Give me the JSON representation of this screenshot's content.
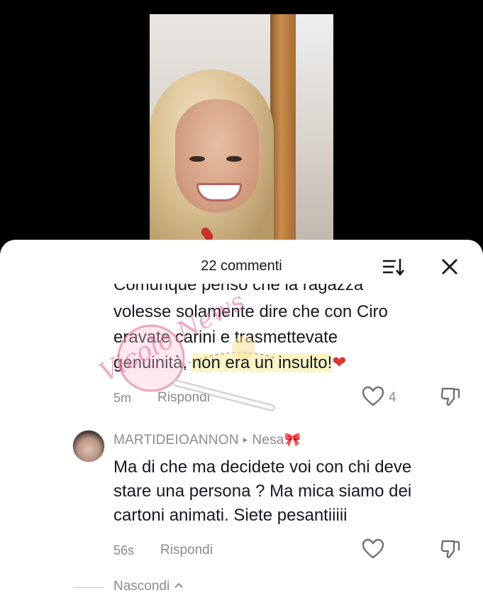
{
  "video": {
    "description_icon": "video-thumbnail"
  },
  "header": {
    "title": "22 commenti",
    "sort_icon": "sort-icon",
    "close_icon": "close-icon"
  },
  "comment1": {
    "line0": "Comunque penso che la ragazza",
    "line1": "volesse solamente dire che con Ciro",
    "line2": "eravate carini e trasmettevate",
    "line3a": "genuinità,",
    "line3b": "non era un insulto!",
    "emoji": "❤",
    "time": "5m",
    "reply": "Rispondi",
    "likes": "4"
  },
  "comment2": {
    "username": "MARTIDEIOANNON",
    "arrow": "▸",
    "reply_to": "Nesa",
    "bow": "🎀",
    "line1": "Ma di che ma decidete voi con chi deve",
    "line2": "stare una persona ? Ma mica siamo dei",
    "line3": "cartoni animati. Siete pesantiiiii",
    "time": "56s",
    "reply": "Rispondi"
  },
  "footer": {
    "hide": "Nascondi",
    "hide_icon": "chevron-up-icon"
  },
  "watermark": {
    "text": "Vicolo News"
  },
  "colors": {
    "accent_text": "#161823",
    "muted": "#8a8b91",
    "highlight": "#fbf4c4",
    "heart": "#e2352f"
  }
}
